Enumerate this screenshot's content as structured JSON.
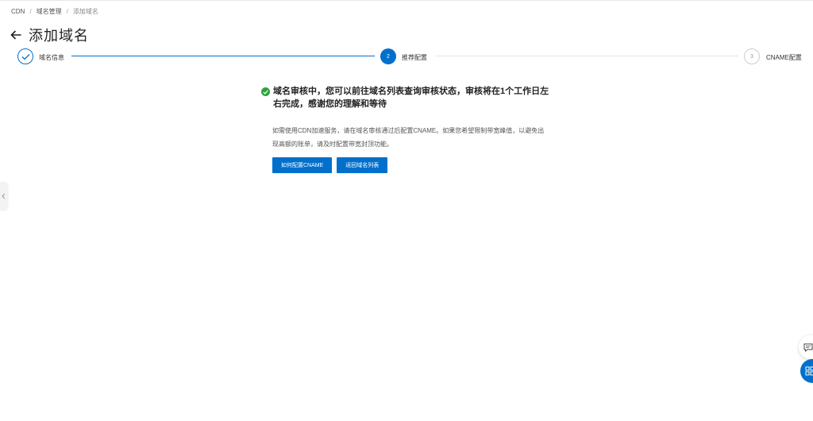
{
  "breadcrumb": {
    "items": [
      "CDN",
      "域名管理",
      "添加域名"
    ],
    "separator": "/"
  },
  "page": {
    "title": "添加域名"
  },
  "steps": [
    {
      "label": "域名信息",
      "state": "done"
    },
    {
      "label": "推荐配置",
      "state": "active",
      "number": "2"
    },
    {
      "label": "CNAME配置",
      "state": "pending",
      "number": "3"
    }
  ],
  "result": {
    "title": "域名审核中，您可以前往域名列表查询审核状态，审核将在1个工作日左右完成，感谢您的理解和等待",
    "description": "如需使用CDN加速服务，请在域名审核通过后配置CNAME。如果您希望限制带宽峰值，以避免出现高额的账单，请及时配置带宽封顶功能。",
    "buttons": {
      "configure_cname": "如何配置CNAME",
      "back_to_list": "返回域名列表"
    }
  },
  "colors": {
    "primary": "#0070cc",
    "success": "#2ca43c"
  }
}
